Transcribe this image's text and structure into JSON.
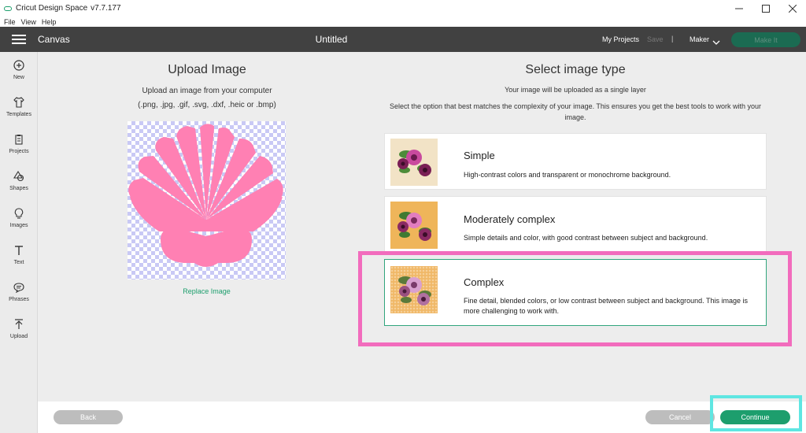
{
  "window": {
    "title": "Cricut Design Space",
    "version": "v7.7.177",
    "controls": [
      "minimize-icon",
      "maximize-icon",
      "close-icon"
    ]
  },
  "menu": [
    "File",
    "View",
    "Help"
  ],
  "header": {
    "menu_icon": "hamburger-icon",
    "section": "Canvas",
    "doc_title": "Untitled",
    "my_projects": "My Projects",
    "save": "Save",
    "separator": "|",
    "machine": "Maker",
    "make_it": "Make It",
    "make_it_color": "#1b6b52"
  },
  "sidebar": {
    "items": [
      {
        "label": "New",
        "icon": "plus-circle-icon"
      },
      {
        "label": "Templates",
        "icon": "shirt-icon"
      },
      {
        "label": "Projects",
        "icon": "clipboard-icon"
      },
      {
        "label": "Shapes",
        "icon": "shapes-icon"
      },
      {
        "label": "Images",
        "icon": "lightbulb-icon"
      },
      {
        "label": "Text",
        "icon": "text-icon"
      },
      {
        "label": "Phrases",
        "icon": "speech-bubble-icon"
      },
      {
        "label": "Upload",
        "icon": "upload-icon"
      }
    ]
  },
  "upload": {
    "title": "Upload Image",
    "subtitle": "Upload an image from your computer",
    "file_types": "(.png, .jpg, .gif, .svg, .dxf, .heic or .bmp)",
    "replace": "Replace Image",
    "image_fill": "#ff80b3"
  },
  "image_type": {
    "title": "Select image type",
    "subtitle": "Your image will be uploaded as a single layer",
    "description": "Select the option that best matches the complexity of your image. This ensures you get the best tools to work with your image.",
    "options": [
      {
        "name": "Simple",
        "description": "High-contrast colors and transparent or monochrome background.",
        "selected": false
      },
      {
        "name": "Moderately complex",
        "description": "Simple details and color, with good contrast between subject and background.",
        "selected": false
      },
      {
        "name": "Complex",
        "description": "Fine detail, blended colors, or low contrast between subject and background. This image is more challenging to work with.",
        "selected": true
      }
    ]
  },
  "footer": {
    "back": "Back",
    "cancel": "Cancel",
    "continue": "Continue",
    "accent": "#1d9e6d"
  }
}
